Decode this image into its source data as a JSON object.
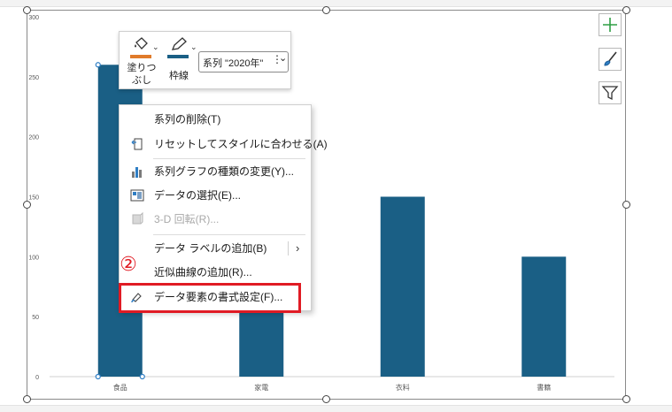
{
  "chart_data": {
    "type": "bar",
    "categories": [
      "食品",
      "家電",
      "衣料",
      "書籍"
    ],
    "series": [
      {
        "name": "2020年",
        "values": [
          260,
          100,
          150,
          100
        ]
      }
    ],
    "yticks": [
      0,
      50,
      100,
      150,
      200,
      250,
      300
    ],
    "ylim": [
      0,
      300
    ],
    "bar_color": "#1a5f85",
    "grid": false,
    "selected_series": "2020年"
  },
  "mini_toolbar": {
    "fill_label": "塗りつ\nぶし",
    "fill_label_line1": "塗りつ",
    "fill_label_line2": "ぶし",
    "outline_label": "枠線",
    "series_select_value": "系列 \"2020年\"",
    "fill_color": "#e07b2a",
    "outline_color": "#1a5f85",
    "fill_icon": "paint-bucket-icon",
    "outline_icon": "pen-icon"
  },
  "side_buttons": {
    "elements_icon": "plus-icon",
    "styles_icon": "brush-icon",
    "filter_icon": "filter-icon"
  },
  "context_menu": {
    "items": [
      {
        "label": "系列の削除(T)",
        "icon": "",
        "disabled": false
      },
      {
        "label": "リセットしてスタイルに合わせる(A)",
        "icon": "reset-style-icon",
        "disabled": false
      },
      {
        "label": "系列グラフの種類の変更(Y)...",
        "icon": "chart-type-icon",
        "disabled": false
      },
      {
        "label": "データの選択(E)...",
        "icon": "select-data-icon",
        "disabled": false
      },
      {
        "label": "3-D 回転(R)...",
        "icon": "rotate-3d-icon",
        "disabled": true
      },
      {
        "label": "データ ラベルの追加(B)",
        "icon": "",
        "disabled": false,
        "submenu": true
      },
      {
        "label": "近似曲線の追加(R)...",
        "icon": "",
        "disabled": false
      },
      {
        "label": "データ要素の書式設定(F)...",
        "icon": "format-data-icon",
        "disabled": false
      }
    ],
    "highlight_color": "#e01b24",
    "step_number": "②"
  }
}
